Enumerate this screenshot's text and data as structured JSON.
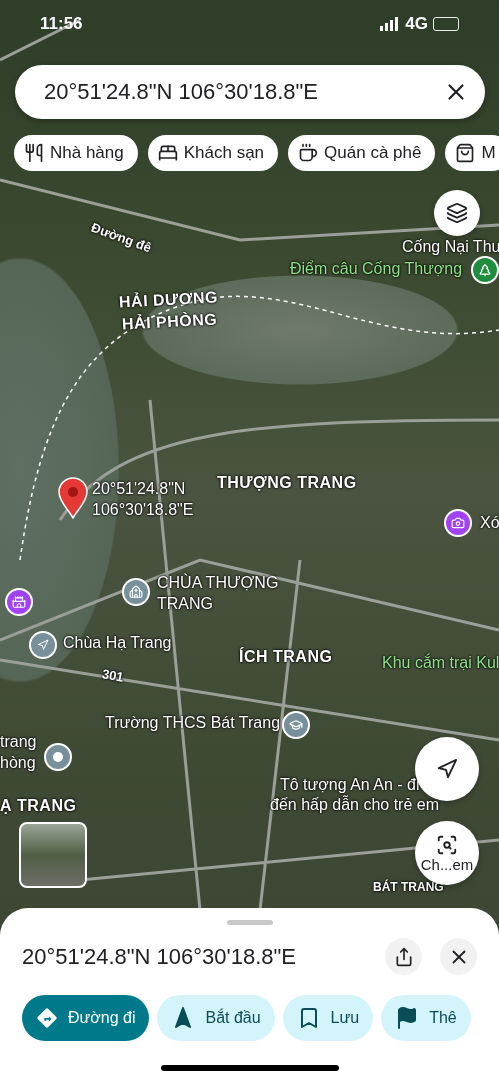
{
  "status_bar": {
    "time": "11:56",
    "network": "4G"
  },
  "search": {
    "value": "20°51'24.8\"N 106°30'18.8\"E"
  },
  "chips": [
    {
      "label": "Nhà hàng",
      "kind": "restaurant"
    },
    {
      "label": "Khách sạn",
      "kind": "hotel"
    },
    {
      "label": "Quán cà phê",
      "kind": "cafe"
    },
    {
      "label": "M",
      "kind": "shopping"
    }
  ],
  "map": {
    "labels": [
      {
        "text": "Đường đê",
        "kind": "road"
      },
      {
        "text": "Cống Nại Thu",
        "kind": "place"
      },
      {
        "text": "Điểm câu Cống Thượng",
        "kind": "park"
      },
      {
        "text": "HẢI DƯƠNG",
        "kind": "region"
      },
      {
        "text": "HẢI PHÒNG",
        "kind": "region"
      },
      {
        "text": "20°51'24.8\"N",
        "kind": "pin"
      },
      {
        "text": "106°30'18.8\"E",
        "kind": "pin"
      },
      {
        "text": "THƯỢNG TRANG",
        "kind": "region"
      },
      {
        "text": "Xó",
        "kind": "place"
      },
      {
        "text": "CHÙA THƯỢNG TRANG",
        "kind": "place"
      },
      {
        "text": "Chùa Hạ Trang",
        "kind": "place"
      },
      {
        "text": "301",
        "kind": "road"
      },
      {
        "text": "ÍCH TRANG",
        "kind": "region"
      },
      {
        "text": "Khu cắm trại Kul",
        "kind": "park"
      },
      {
        "text": "Trường THCS Bát Trang",
        "kind": "place"
      },
      {
        "text": "trang",
        "kind": "place"
      },
      {
        "text": "hòng",
        "kind": "place"
      },
      {
        "text": "Ạ TRANG",
        "kind": "region"
      },
      {
        "text": "Tô tượng An An - đi",
        "kind": "place"
      },
      {
        "text": "đến hấp dẫn cho trẻ em",
        "kind": "place"
      },
      {
        "text": "BÁT TRANG",
        "kind": "small"
      }
    ],
    "lens_label": "Ch...em"
  },
  "sheet": {
    "title": "20°51'24.8\"N 106°30'18.8\"E",
    "actions": [
      {
        "label": "Đường đi",
        "kind": "directions",
        "selected": true
      },
      {
        "label": "Bắt đầu",
        "kind": "start",
        "selected": false
      },
      {
        "label": "Lưu",
        "kind": "save",
        "selected": false
      },
      {
        "label": "Thê",
        "kind": "flag",
        "selected": false
      }
    ]
  }
}
